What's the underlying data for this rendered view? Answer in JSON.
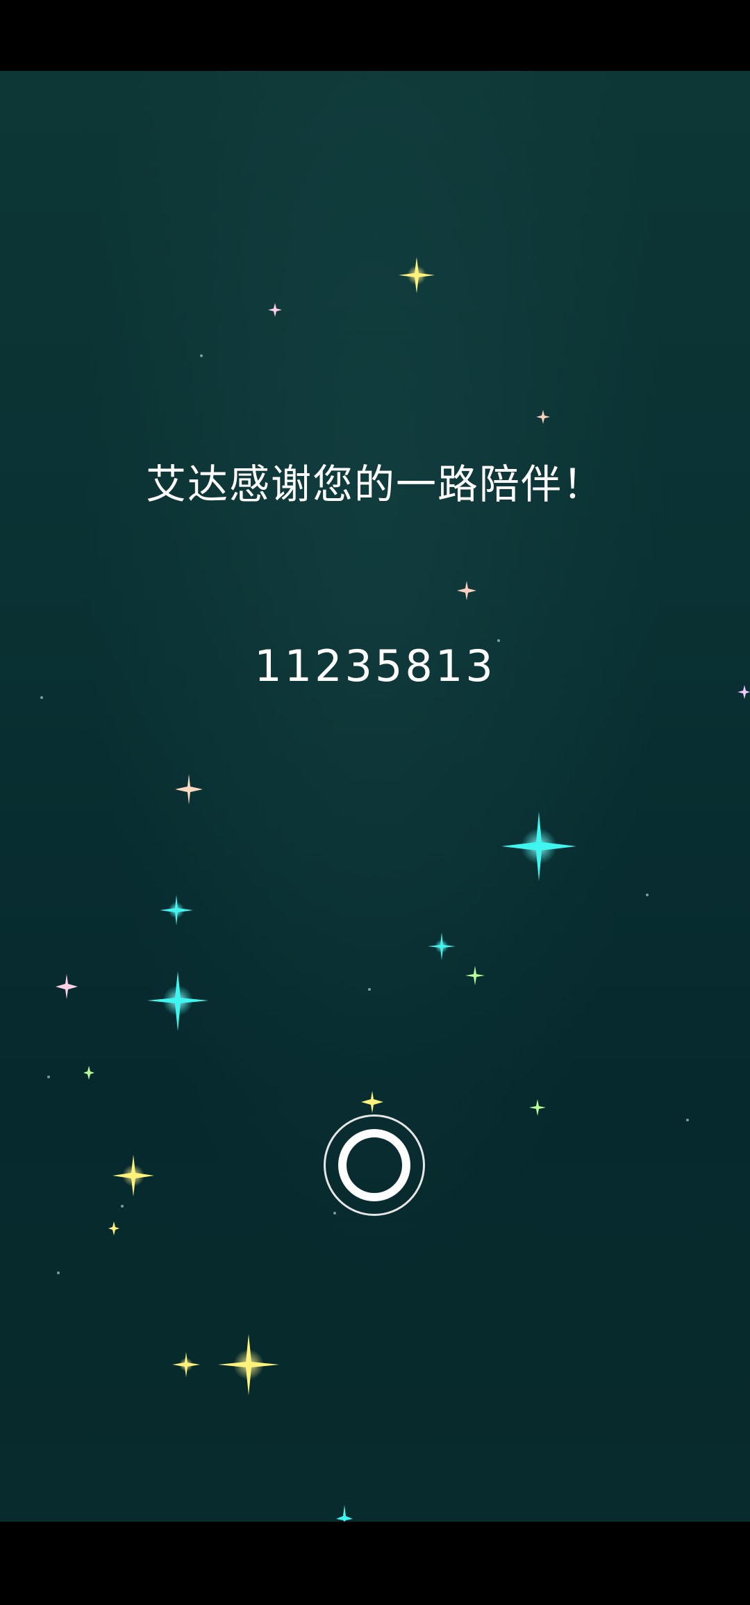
{
  "screen": {
    "message": "艾达感谢您的一路陪伴！",
    "code": "11235813"
  },
  "colors": {
    "background_top": "#0d3636",
    "background_bottom": "#06292d",
    "text": "#ffffff",
    "star_yellow": "#fff27a",
    "star_cyan": "#3ff5f0",
    "star_pink": "#ffd0e8",
    "star_green": "#b8ff9a"
  },
  "icons": {
    "center_button": "ring-button-icon",
    "decoration": "sparkle-star-icon"
  }
}
